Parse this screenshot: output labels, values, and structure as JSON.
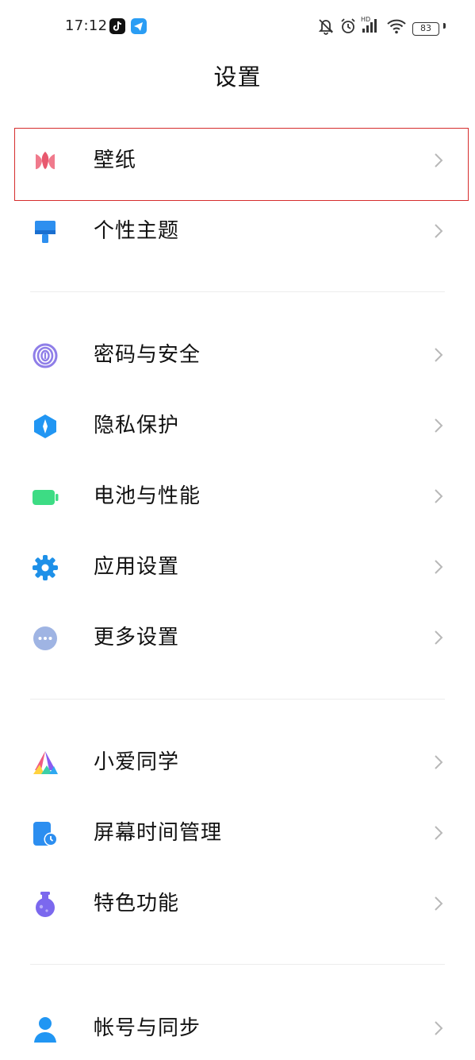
{
  "status_bar": {
    "time": "17:12",
    "notification_icons": [
      "tiktok-icon",
      "telegram-icon"
    ],
    "system_icons": [
      "silent-bell-icon",
      "alarm-icon",
      "hd-signal-icon",
      "wifi-icon"
    ],
    "signal_label": "HD",
    "battery": "83"
  },
  "header": {
    "title": "设置"
  },
  "groups": [
    {
      "items": [
        {
          "label": "壁纸",
          "icon": "tulip-icon",
          "color": "#f07a8c"
        },
        {
          "label": "个性主题",
          "icon": "paint-brush-icon",
          "color": "#2d8fef"
        }
      ]
    },
    {
      "items": [
        {
          "label": "密码与安全",
          "icon": "fingerprint-icon",
          "color": "#8f7ee8"
        },
        {
          "label": "隐私保护",
          "icon": "privacy-shield-icon",
          "color": "#2196f3"
        },
        {
          "label": "电池与性能",
          "icon": "battery-icon",
          "color": "#3ddc84"
        },
        {
          "label": "应用设置",
          "icon": "gear-icon",
          "color": "#1e90e8"
        },
        {
          "label": "更多设置",
          "icon": "more-dots-icon",
          "color": "#9fb4e3"
        }
      ]
    },
    {
      "items": [
        {
          "label": "小爱同学",
          "icon": "xiaoai-icon",
          "color": "#f05a82"
        },
        {
          "label": "屏幕时间管理",
          "icon": "screen-time-icon",
          "color": "#2c8ef0"
        },
        {
          "label": "特色功能",
          "icon": "flask-icon",
          "color": "#7b68ee"
        }
      ]
    },
    {
      "items": [
        {
          "label": "帐号与同步",
          "icon": "account-icon",
          "color": "#2196f3"
        }
      ]
    }
  ],
  "highlight": {
    "target": "壁纸",
    "color": "#d62d2d"
  }
}
